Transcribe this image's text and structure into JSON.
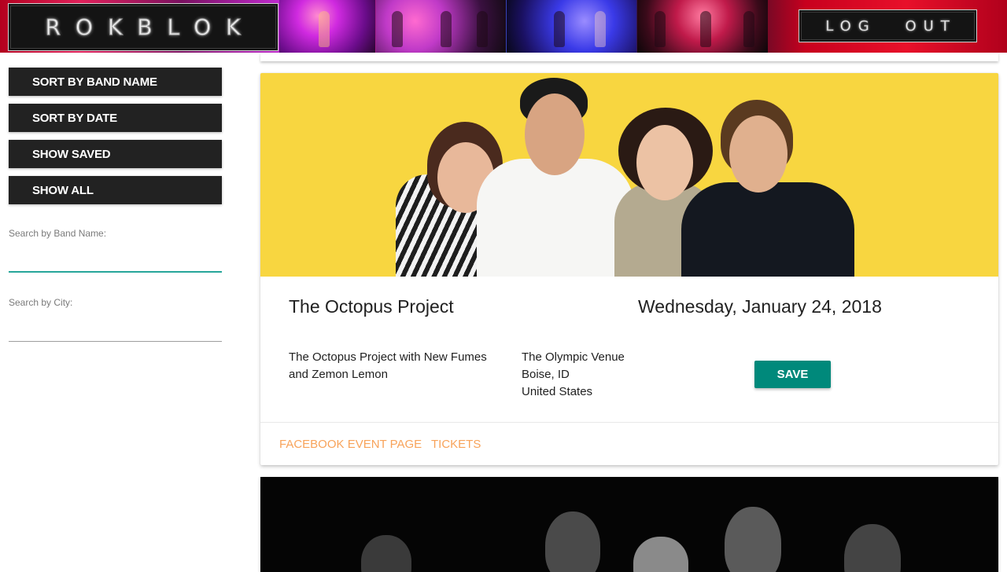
{
  "header": {
    "logo_text": "ROKBLOK",
    "logout_label": "LOG OUT",
    "banner_photos": [
      "concert-photo",
      "concert-photo",
      "concert-photo",
      "concert-photo"
    ]
  },
  "sidebar": {
    "buttons": [
      {
        "label": "SORT BY BAND NAME"
      },
      {
        "label": "SORT BY DATE"
      },
      {
        "label": "SHOW SAVED"
      },
      {
        "label": "SHOW ALL"
      }
    ],
    "band_search": {
      "label": "Search by Band Name:",
      "value": ""
    },
    "city_search": {
      "label": "Search by City:",
      "value": ""
    }
  },
  "events": [
    {
      "band_name": "The Octopus Project",
      "date": "Wednesday, January 24, 2018",
      "description": "The Octopus Project with New Fumes and Zemon Lemon",
      "venue": {
        "name": "The Olympic Venue",
        "city": "Boise, ID",
        "country": "United States"
      },
      "save_label": "SAVE",
      "links": {
        "facebook": "FACEBOOK EVENT PAGE",
        "tickets": "TICKETS"
      }
    }
  ],
  "colors": {
    "accent_teal": "#00897b",
    "link_orange": "#f8a35a",
    "sidebar_button": "#222222",
    "input_focus": "#26a69a",
    "band_photo_bg": "#f8d640"
  }
}
